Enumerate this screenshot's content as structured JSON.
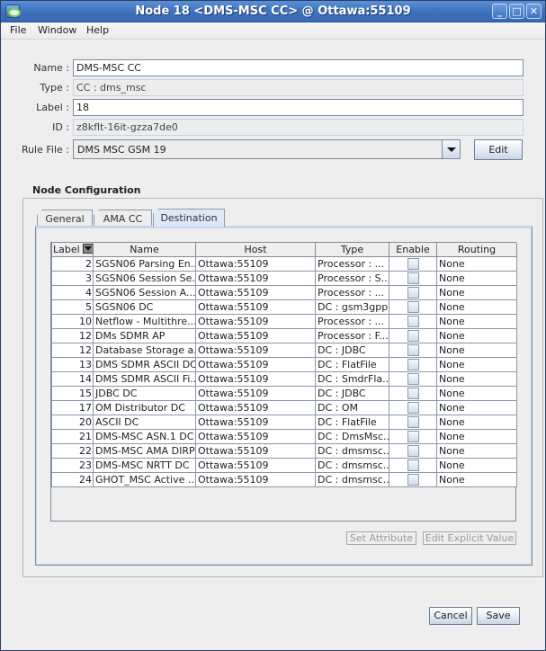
{
  "window": {
    "title": "Node 18 <DMS-MSC CC> @ Ottawa:55109",
    "controls": {
      "minimize": "_",
      "maximize": "□",
      "close": "✕"
    }
  },
  "menubar": {
    "items": [
      "File",
      "Window",
      "Help"
    ]
  },
  "form": {
    "name_label": "Name :",
    "name_value": "DMS-MSC CC",
    "type_label": "Type :",
    "type_value": "CC : dms_msc",
    "label_label": "Label :",
    "label_value": "18",
    "id_label": "ID :",
    "id_value": "z8kflt-16it-gzza7de0",
    "rule_file_label": "Rule File :",
    "rule_file_value": "DMS MSC GSM 19",
    "edit_button": "Edit"
  },
  "node_config": {
    "title": "Node Configuration",
    "tabs": [
      {
        "label": "General",
        "active": false
      },
      {
        "label": "AMA CC",
        "active": false
      },
      {
        "label": "Destination",
        "active": true
      }
    ],
    "table": {
      "columns": [
        "Label",
        "Name",
        "Host",
        "Type",
        "Enable",
        "Routing"
      ],
      "rows": [
        {
          "label": "2",
          "name": "SGSN06 Parsing En...",
          "host": "Ottawa:55109",
          "type": "Processor : ...",
          "enable": false,
          "routing": "None"
        },
        {
          "label": "3",
          "name": "SGSN06 Session Se...",
          "host": "Ottawa:55109",
          "type": "Processor : S...",
          "enable": false,
          "routing": "None"
        },
        {
          "label": "4",
          "name": "SGSN06 Session A...",
          "host": "Ottawa:55109",
          "type": "Processor : ...",
          "enable": false,
          "routing": "None"
        },
        {
          "label": "5",
          "name": "SGSN06 DC",
          "host": "Ottawa:55109",
          "type": "DC : gsm3gpp",
          "enable": false,
          "routing": "None"
        },
        {
          "label": "10",
          "name": "Netflow - Multithre...",
          "host": "Ottawa:55109",
          "type": "Processor : ...",
          "enable": false,
          "routing": "None"
        },
        {
          "label": "12",
          "name": "DMs SDMR AP",
          "host": "Ottawa:55109",
          "type": "Processor : F...",
          "enable": false,
          "routing": "None"
        },
        {
          "label": "12",
          "name": "Database Storage a...",
          "host": "Ottawa:55109",
          "type": "DC : JDBC",
          "enable": false,
          "routing": "None"
        },
        {
          "label": "13",
          "name": "DMS SDMR ASCII DC",
          "host": "Ottawa:55109",
          "type": "DC : FlatFile",
          "enable": false,
          "routing": "None"
        },
        {
          "label": "14",
          "name": "DMS SDMR ASCII Fi...",
          "host": "Ottawa:55109",
          "type": "DC : SmdrFla...",
          "enable": false,
          "routing": "None"
        },
        {
          "label": "15",
          "name": "JDBC DC",
          "host": "Ottawa:55109",
          "type": "DC : JDBC",
          "enable": false,
          "routing": "None"
        },
        {
          "label": "17",
          "name": "OM Distributor DC",
          "host": "Ottawa:55109",
          "type": "DC : OM",
          "enable": false,
          "routing": "None"
        },
        {
          "label": "20",
          "name": "ASCII DC",
          "host": "Ottawa:55109",
          "type": "DC : FlatFile",
          "enable": false,
          "routing": "None"
        },
        {
          "label": "21",
          "name": "DMS-MSC ASN.1 DC",
          "host": "Ottawa:55109",
          "type": "DC : DmsMsc...",
          "enable": false,
          "routing": "None"
        },
        {
          "label": "22",
          "name": "DMS-MSC AMA DIRP",
          "host": "Ottawa:55109",
          "type": "DC : dmsmsc...",
          "enable": false,
          "routing": "None"
        },
        {
          "label": "23",
          "name": "DMS-MSC NRTT DC",
          "host": "Ottawa:55109",
          "type": "DC : dmsmsc...",
          "enable": false,
          "routing": "None"
        },
        {
          "label": "24",
          "name": "GHOT_MSC Active ...",
          "host": "Ottawa:55109",
          "type": "DC : dmsmsc...",
          "enable": false,
          "routing": "None"
        }
      ]
    },
    "set_attribute_button": "Set Attribute",
    "edit_explicit_button": "Edit Explicit Value"
  },
  "footer": {
    "cancel_button": "Cancel",
    "save_button": "Save"
  }
}
